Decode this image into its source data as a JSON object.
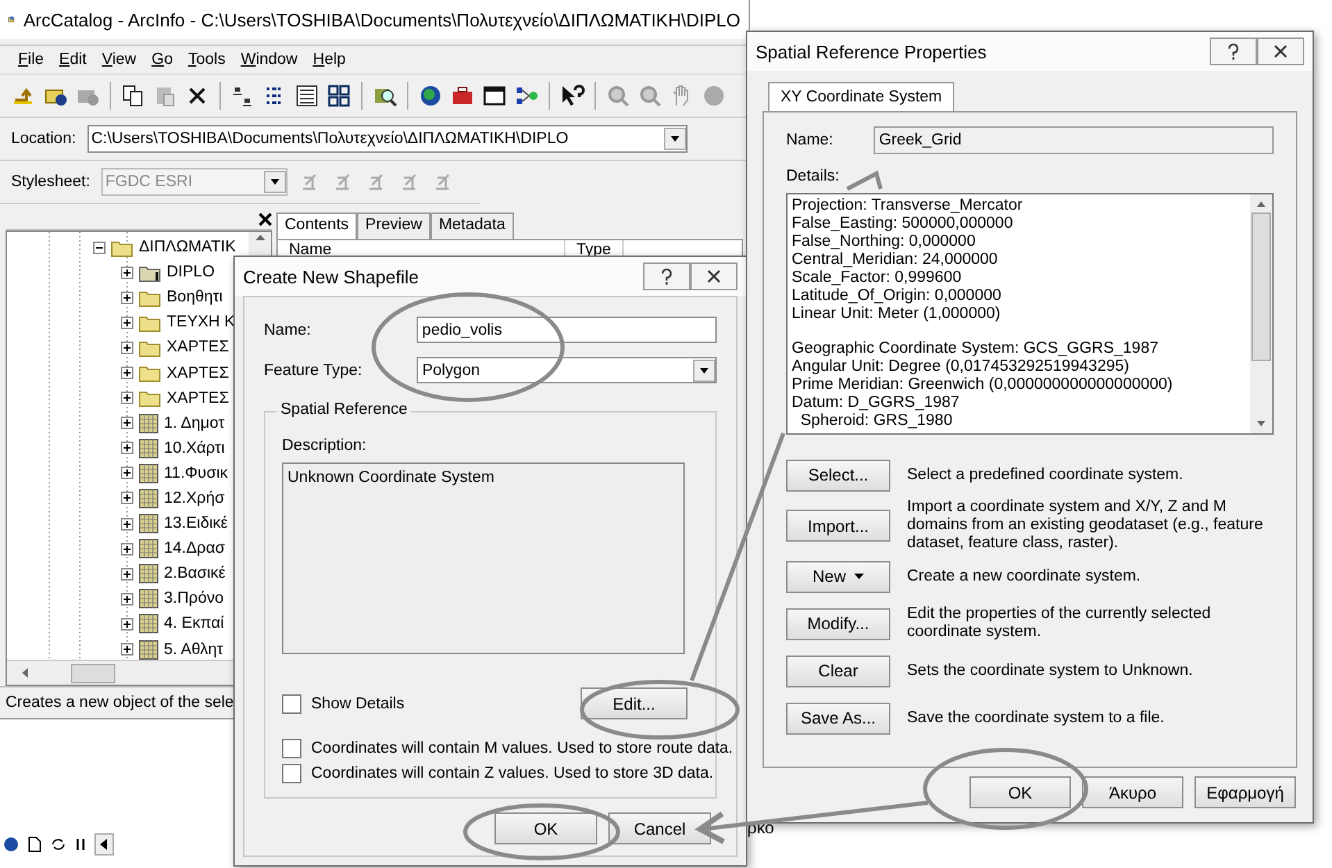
{
  "main_window": {
    "title": "ArcCatalog - ArcInfo - C:\\Users\\TOSHIBA\\Documents\\Πολυτεχνείο\\ΔΙΠΛΩΜΑΤΙΚΗ\\DIPLO",
    "menu": [
      "File",
      "Edit",
      "View",
      "Go",
      "Tools",
      "Window",
      "Help"
    ],
    "location": {
      "label": "Location:",
      "value": "C:\\Users\\TOSHIBA\\Documents\\Πολυτεχνείο\\ΔΙΠΛΩΜΑΤΙΚΗ\\DIPLO"
    },
    "stylesheet": {
      "label": "Stylesheet:",
      "value": "FGDC ESRI",
      "disabled": true
    },
    "tree": [
      {
        "label": "ΔΙΠΛΩΜΑΤΙΚ",
        "kind": "folder",
        "expanded": true,
        "children": [
          {
            "label": "DIPLO",
            "kind": "connection",
            "expanded": false
          },
          {
            "label": "Βοηθητι",
            "kind": "folder",
            "expanded": false
          },
          {
            "label": "ΤΕΥΧΗ Κ",
            "kind": "folder",
            "expanded": false
          },
          {
            "label": "ΧΑΡΤΕΣ",
            "kind": "folder",
            "expanded": false
          },
          {
            "label": "ΧΑΡΤΕΣ",
            "kind": "folder",
            "expanded": false
          },
          {
            "label": "ΧΑΡΤΕΣ",
            "kind": "folder",
            "expanded": false
          },
          {
            "label": "1. Δημοτ",
            "kind": "raster",
            "expanded": false
          },
          {
            "label": "10.Χάρτι",
            "kind": "raster",
            "expanded": false
          },
          {
            "label": "11.Φυσικ",
            "kind": "raster",
            "expanded": false
          },
          {
            "label": "12.Χρήσ",
            "kind": "raster",
            "expanded": false
          },
          {
            "label": "13.Ειδικέ",
            "kind": "raster",
            "expanded": false
          },
          {
            "label": "14.Δρασ",
            "kind": "raster",
            "expanded": false
          },
          {
            "label": "2.Βασικέ",
            "kind": "raster",
            "expanded": false
          },
          {
            "label": "3.Πρόνο",
            "kind": "raster",
            "expanded": false
          },
          {
            "label": "4. Εκπαί",
            "kind": "raster",
            "expanded": false
          },
          {
            "label": "5. Αθλητ",
            "kind": "raster",
            "expanded": false
          }
        ]
      }
    ],
    "content_tabs": [
      {
        "label": "Contents",
        "selected": true
      },
      {
        "label": "Preview",
        "selected": false
      },
      {
        "label": "Metadata",
        "selected": false
      }
    ],
    "columns": [
      "Name",
      "Type"
    ],
    "status_bar": "Creates a new object of the sele"
  },
  "create_shapefile_dialog": {
    "title": "Create New Shapefile",
    "name_label": "Name:",
    "name_value": "pedio_volis",
    "feature_type_label": "Feature Type:",
    "feature_type": "Polygon",
    "group_label": "Spatial Reference",
    "description_label": "Description:",
    "description": "Unknown Coordinate System",
    "show_details": {
      "label": "Show Details",
      "checked": false
    },
    "edit_button": "Edit...",
    "options": [
      {
        "label": "Coordinates will contain M values. Used to store route data.",
        "checked": false
      },
      {
        "label": "Coordinates will contain Z values. Used to store 3D data.",
        "checked": false
      }
    ],
    "buttons": [
      "OK",
      "Cancel"
    ]
  },
  "spatial_reference_dialog": {
    "title": "Spatial Reference Properties",
    "tabs": [
      {
        "label": "XY Coordinate System",
        "selected": true
      }
    ],
    "name_label": "Name:",
    "name_value": "Greek_Grid",
    "details_label": "Details:",
    "details": [
      [
        "Projection: Transverse_Mercator",
        "False_Easting: 500000,000000",
        "False_Northing: 0,000000",
        "Central_Meridian: 24,000000",
        "Scale_Factor: 0,999600",
        "Latitude_Of_Origin: 0,000000",
        "Linear Unit: Meter (1,000000)"
      ],
      [
        "Geographic Coordinate System: GCS_GGRS_1987",
        "Angular Unit: Degree (0,017453292519943295)",
        "Prime Meridian: Greenwich (0,000000000000000000)",
        "Datum: D_GGRS_1987",
        "  Spheroid: GRS_1980"
      ]
    ],
    "actions": [
      {
        "button": "Select...",
        "kind": "plain",
        "description": "Select a predefined coordinate system."
      },
      {
        "button": "Import...",
        "kind": "plain",
        "description": "Import a coordinate system and X/Y, Z and M domains from an existing geodataset (e.g., feature dataset, feature class, raster)."
      },
      {
        "button": "New",
        "kind": "menu",
        "description": "Create a new coordinate system."
      },
      {
        "button": "Modify...",
        "kind": "plain",
        "description": "Edit the properties of the currently selected coordinate system."
      },
      {
        "button": "Clear",
        "kind": "plain",
        "description": "Sets the coordinate system to Unknown."
      },
      {
        "button": "Save As...",
        "kind": "plain",
        "description": "Save the coordinate system to a file."
      }
    ],
    "buttons": [
      "OK",
      "Άκυρο",
      "Εφαρμογή"
    ]
  },
  "desktop": {
    "fragment": "ρκο"
  }
}
